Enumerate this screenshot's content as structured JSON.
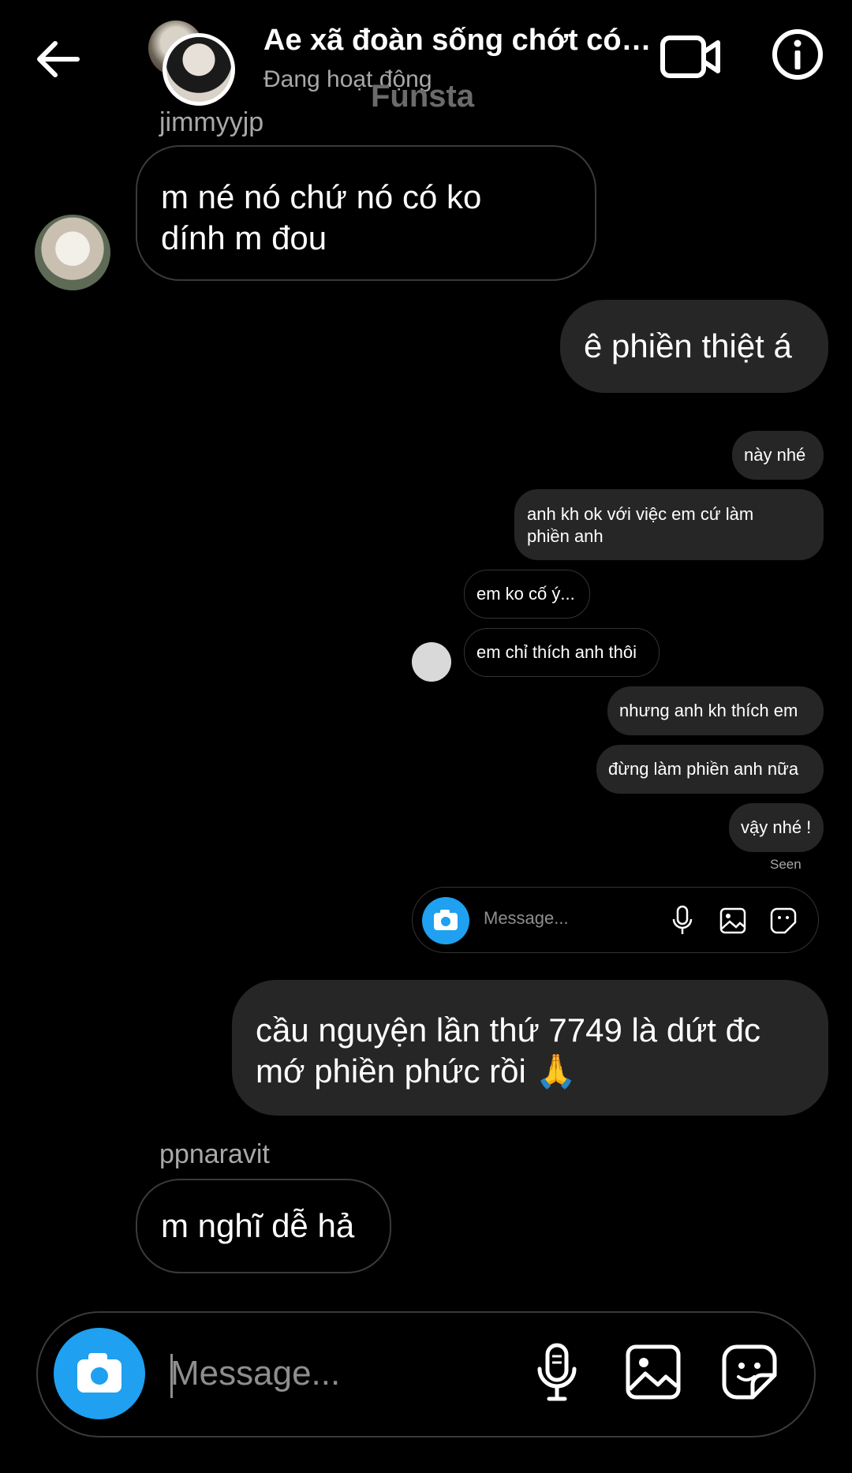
{
  "header": {
    "title": "Ae xã đoàn sống chớt có n...",
    "status": "Đang hoạt động",
    "watermark": "Funsta"
  },
  "messages": [
    {
      "sender": "jimmyyjp",
      "text_line1": "m né nó chứ nó có ko",
      "text_line2": "dính m đou",
      "direction": "incoming"
    },
    {
      "text": "ê phiền thiệt á",
      "direction": "outgoing"
    },
    {
      "text_line1": "cầu nguyện lần thứ 7749 là dứt đc",
      "text_line2": "mớ phiền phức rồi 🙏",
      "direction": "outgoing"
    },
    {
      "sender": "ppnaravit",
      "text": "m nghĩ dễ hả",
      "direction": "incoming"
    }
  ],
  "screenshot": {
    "messages": [
      {
        "text": "này nhé",
        "direction": "outgoing"
      },
      {
        "text_line1": "anh kh ok với việc em cứ làm",
        "text_line2": "phiền anh",
        "direction": "outgoing"
      },
      {
        "text": "em ko cố ý...",
        "direction": "incoming"
      },
      {
        "text": "em chỉ thích anh thôi",
        "direction": "incoming"
      },
      {
        "text": "nhưng anh kh thích em",
        "direction": "outgoing"
      },
      {
        "text": "đừng làm phiền anh nữa",
        "direction": "outgoing"
      },
      {
        "text": "vậy nhé !",
        "direction": "outgoing"
      }
    ],
    "seen": "Seen",
    "input_placeholder": "Message..."
  },
  "composer": {
    "placeholder": "Message..."
  },
  "colors": {
    "background": "#000000",
    "bubble_outgoing": "#262626",
    "bubble_incoming_border": "#3a3a3a",
    "accent_camera": "#1fa0f0",
    "secondary_text": "#a8a8a8"
  },
  "icons": [
    "back-arrow-icon",
    "video-call-icon",
    "info-icon",
    "camera-icon",
    "microphone-icon",
    "gallery-icon",
    "sticker-icon"
  ]
}
